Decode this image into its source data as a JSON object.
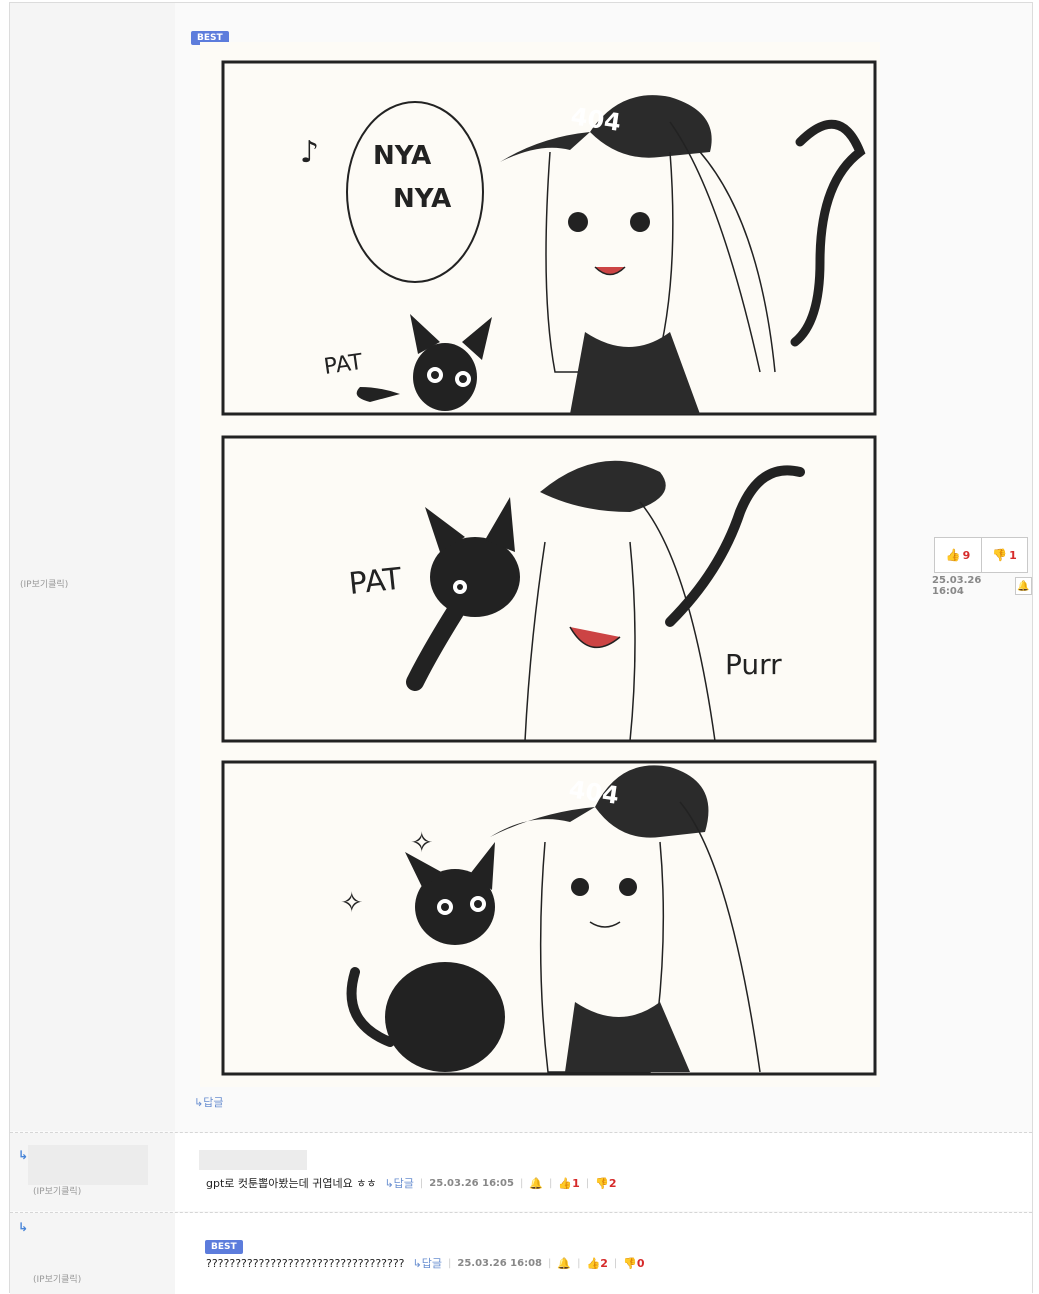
{
  "comments": [
    {
      "badge": "BEST",
      "ip_label": "(IP보기클릭)",
      "up": "9",
      "down": "1",
      "timestamp": "25.03.26 16:04",
      "reply_label": "↳답글",
      "comic": {
        "panel1_text": [
          "NYA",
          "NYA",
          "PAT"
        ],
        "panel2_text": [
          "PAT",
          "Purr"
        ],
        "cap_text": "404"
      }
    },
    {
      "ip_label": "(IP보기클릭)",
      "text": "gpt로 컷툰뽑아봤는데 귀엽네요 ㅎㅎ",
      "reply_label": "↳답글",
      "timestamp": "25.03.26 16:05",
      "up": "1",
      "down": "2"
    },
    {
      "badge": "BEST",
      "ip_label": "(IP보기클릭)",
      "text": "??????????????????????????????????",
      "reply_label": "↳답글",
      "timestamp": "25.03.26 16:08",
      "up": "2",
      "down": "0"
    }
  ],
  "colors": {
    "accent": "#5c7cdc",
    "vote_up": "#3a6fd8",
    "count": "#d62a2a"
  },
  "icons": [
    "thumbs-up-icon",
    "thumbs-down-icon",
    "bell-icon",
    "reply-arrow-icon"
  ]
}
